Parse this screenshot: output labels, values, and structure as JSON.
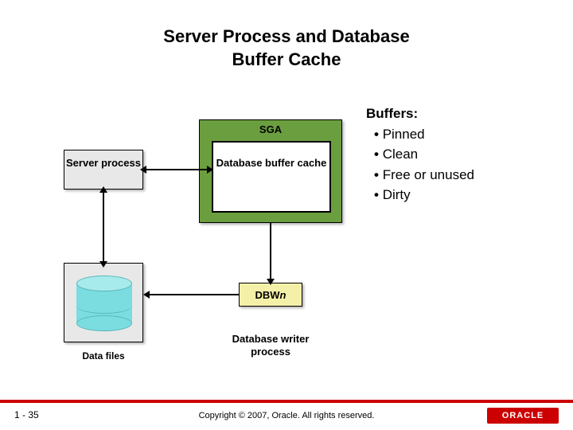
{
  "title_line1": "Server Process and Database",
  "title_line2": "Buffer Cache",
  "sga_label": "SGA",
  "buffer_cache_label": "Database buffer cache",
  "server_process_label": "Server process",
  "buffers": {
    "heading": "Buffers:",
    "items": [
      "Pinned",
      "Clean",
      "Free or unused",
      "Dirty"
    ]
  },
  "dbwn_label_prefix": "DBW",
  "dbwn_label_suffix": "n",
  "db_writer_label": "Database writer process",
  "datafiles_label": "Data files",
  "slide_number": "1 - 35",
  "copyright": "Copyright © 2007, Oracle. All rights reserved.",
  "logo_text": "ORACLE"
}
